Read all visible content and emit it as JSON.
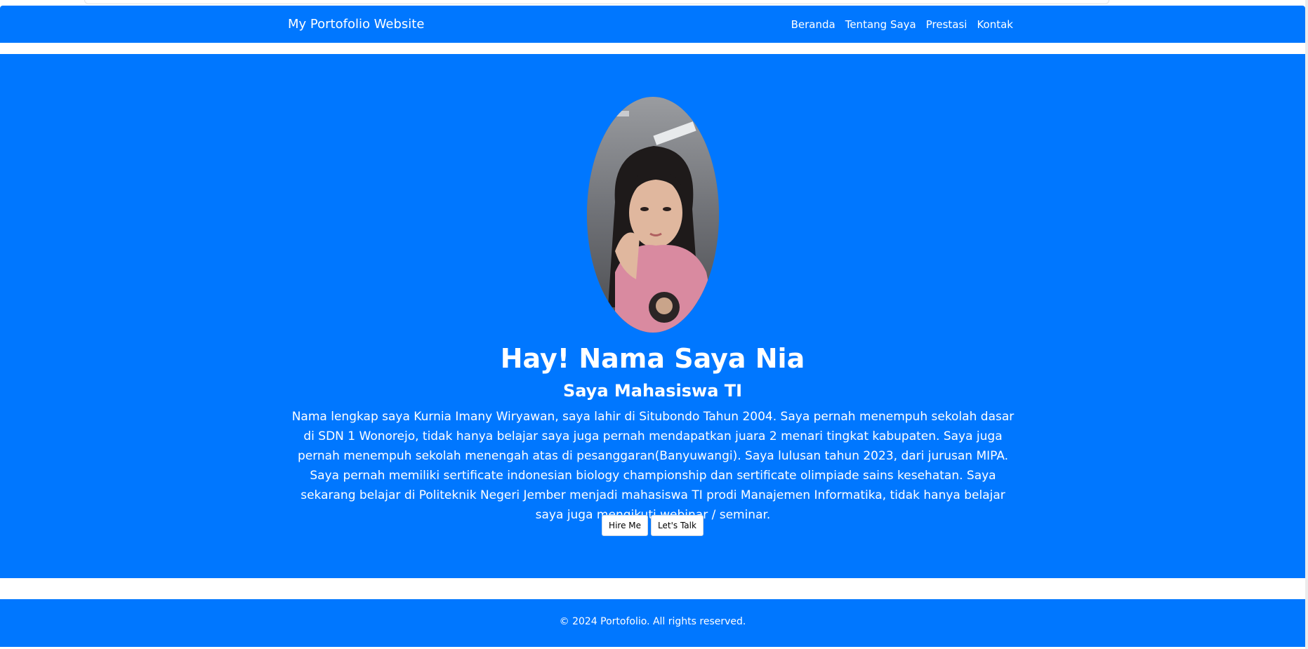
{
  "navbar": {
    "brand": "My Portofolio Website",
    "links": [
      "Beranda",
      "Tentang Saya",
      "Prestasi",
      "Kontak"
    ]
  },
  "hero": {
    "title": "Hay! Nama Saya Nia",
    "subtitle": "Saya Mahasiswa TI",
    "description": "Nama lengkap saya Kurnia Imany Wiryawan, saya lahir di Situbondo Tahun 2004. Saya pernah menempuh sekolah dasar di SDN 1 Wonorejo, tidak hanya belajar saya juga pernah mendapatkan juara 2 menari tingkat kabupaten. Saya juga pernah menempuh sekolah menengah atas di pesanggaran(Banyuwangi). Saya lulusan tahun 2023, dari jurusan MIPA. Saya pernah memiliki sertificate indonesian biology championship dan sertificate olimpiade sains kesehatan. Saya sekarang belajar di Politeknik Negeri Jember menjadi mahasiswa TI prodi Manajemen Informatika, tidak hanya belajar saya juga mengikuti webinar / seminar.",
    "buttons": {
      "hire": "Hire Me",
      "talk": "Let's Talk"
    }
  },
  "footer": {
    "text": "© 2024 Portofolio. All rights reserved."
  },
  "colors": {
    "primary": "#0077ff",
    "text_on_primary": "#ffffff"
  }
}
